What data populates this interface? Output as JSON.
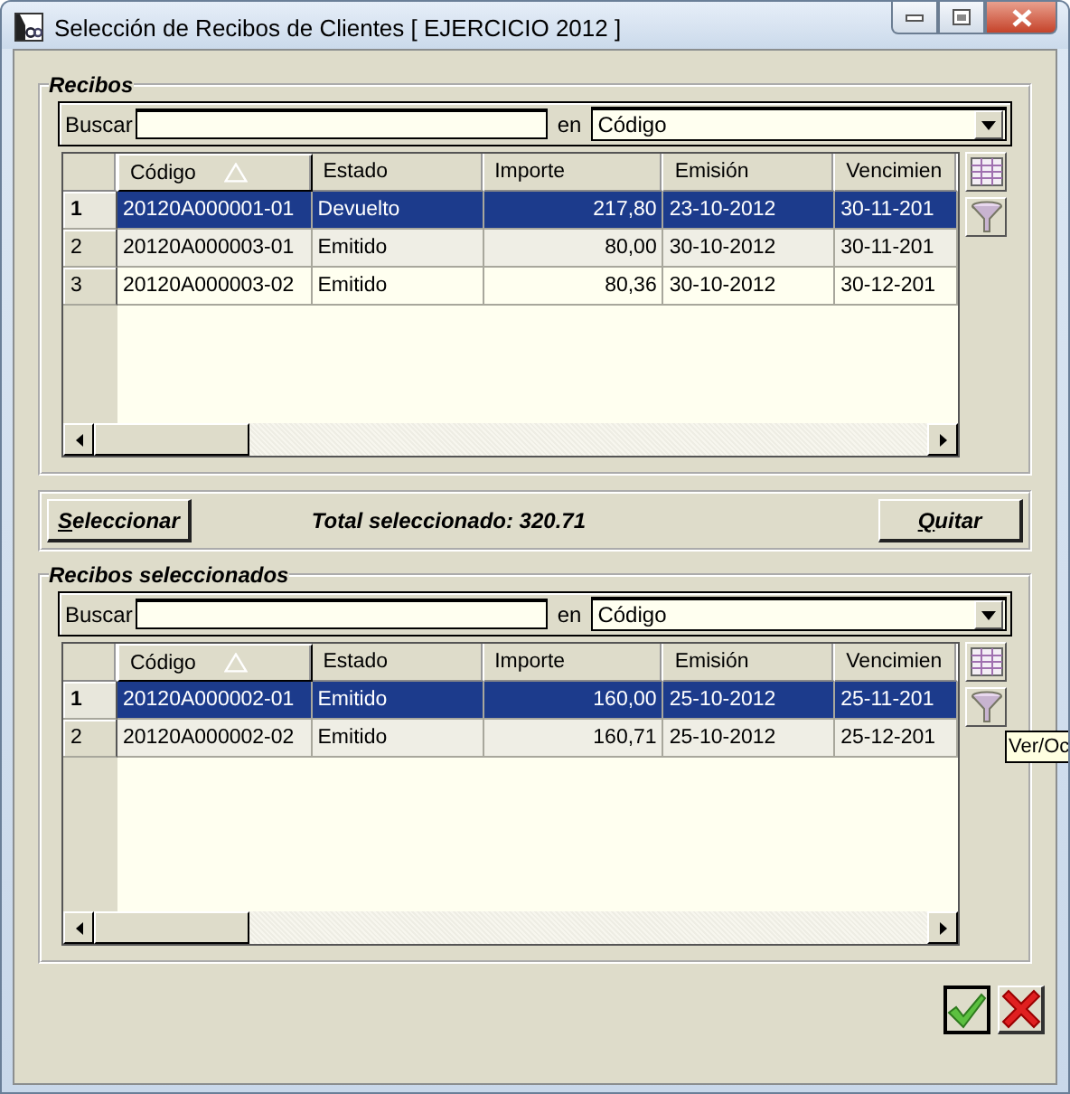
{
  "window": {
    "title": "Selección de Recibos de Clientes [ EJERCICIO 2012 ]"
  },
  "sections": [
    {
      "kind": "table_panel",
      "title": "Recibos",
      "search": {
        "label": "Buscar",
        "in_label": "en",
        "field": "Código"
      },
      "columns": [
        {
          "label": "Código",
          "sorted": true
        },
        {
          "label": "Estado",
          "sorted": false
        },
        {
          "label": "Importe",
          "sorted": false
        },
        {
          "label": "Emisión",
          "sorted": false
        },
        {
          "label": "Vencimien",
          "sorted": false
        }
      ],
      "rows": [
        {
          "number": "1",
          "selected": true,
          "cells": [
            "20120A000001-01",
            "Devuelto",
            "217,80",
            "23-10-2012",
            "30-11-201"
          ]
        },
        {
          "number": "2",
          "selected": false,
          "cells": [
            "20120A000003-01",
            "Emitido",
            "80,00",
            "30-10-2012",
            "30-11-201"
          ]
        },
        {
          "number": "3",
          "selected": false,
          "cells": [
            "20120A000003-02",
            "Emitido",
            "80,36",
            "30-10-2012",
            "30-12-201"
          ]
        }
      ]
    },
    {
      "kind": "selection_bar",
      "select_button": "Seleccionar",
      "total": "Total seleccionado: 320.71",
      "remove_button": "Quitar"
    },
    {
      "kind": "table_panel",
      "title": "Recibos seleccionados",
      "search": {
        "label": "Buscar",
        "in_label": "en",
        "field": "Código"
      },
      "columns": [
        {
          "label": "Código",
          "sorted": true
        },
        {
          "label": "Estado",
          "sorted": false
        },
        {
          "label": "Importe",
          "sorted": false
        },
        {
          "label": "Emisión",
          "sorted": false
        },
        {
          "label": "Vencimien",
          "sorted": false
        }
      ],
      "rows": [
        {
          "number": "1",
          "selected": true,
          "cells": [
            "20120A000002-01",
            "Emitido",
            "160,00",
            "25-10-2012",
            "25-11-201"
          ]
        },
        {
          "number": "2",
          "selected": false,
          "cells": [
            "20120A000002-02",
            "Emitido",
            "160,71",
            "25-10-2012",
            "25-12-201"
          ]
        }
      ],
      "tooltip": "Ver/Oc"
    }
  ]
}
